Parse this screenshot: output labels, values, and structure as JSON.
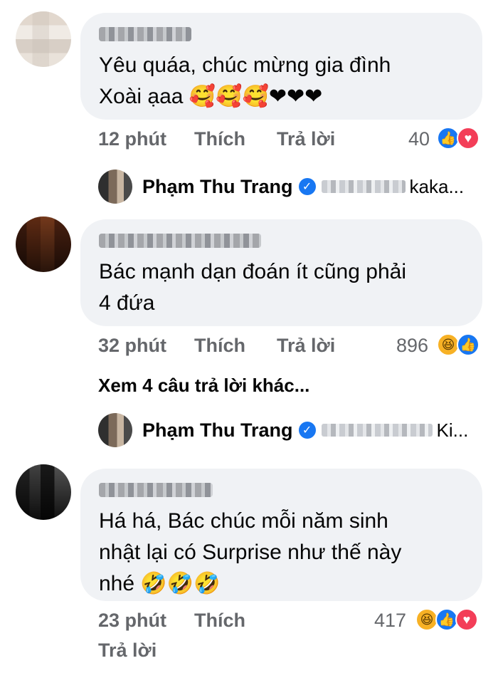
{
  "comments": [
    {
      "text_line1": "Yêu quáa, chúc mừng gia đình",
      "text_line2": "Xoài ạaa",
      "emojis": "🥰🥰🥰❤❤❤",
      "time": "12 phút",
      "like": "Thích",
      "reply": "Trả lời",
      "reaction_count": "40",
      "reactions": [
        "like-icon",
        "heart-icon"
      ]
    },
    {
      "text_line1": "Bác mạnh dạn đoán ít cũng phải",
      "text_line2": "4 đứa",
      "time": "32 phút",
      "like": "Thích",
      "reply": "Trả lời",
      "reaction_count": "896",
      "reactions": [
        "haha-icon",
        "like-icon"
      ]
    },
    {
      "text_line1": "Há há, Bác chúc mỗi năm sinh",
      "text_line2": "nhật lại có Surprise như thế này",
      "text_line3": "nhé",
      "emojis": "🤣🤣🤣",
      "time": "23 phút",
      "like": "Thích",
      "reply": "Trả lời",
      "reaction_count": "417",
      "reactions": [
        "haha-icon",
        "like-icon",
        "heart-icon"
      ]
    }
  ],
  "replies": [
    {
      "author": "Phạm Thu Trang",
      "preview": "kaka..."
    },
    {
      "author": "Phạm Thu Trang",
      "preview": "Ki..."
    }
  ],
  "view_more": "Xem 4 câu trả lời khác...",
  "colors": {
    "bubble": "#f0f2f5",
    "meta": "#65676b",
    "like": "#1877f2",
    "heart": "#f33e58",
    "haha": "#f7b125"
  }
}
